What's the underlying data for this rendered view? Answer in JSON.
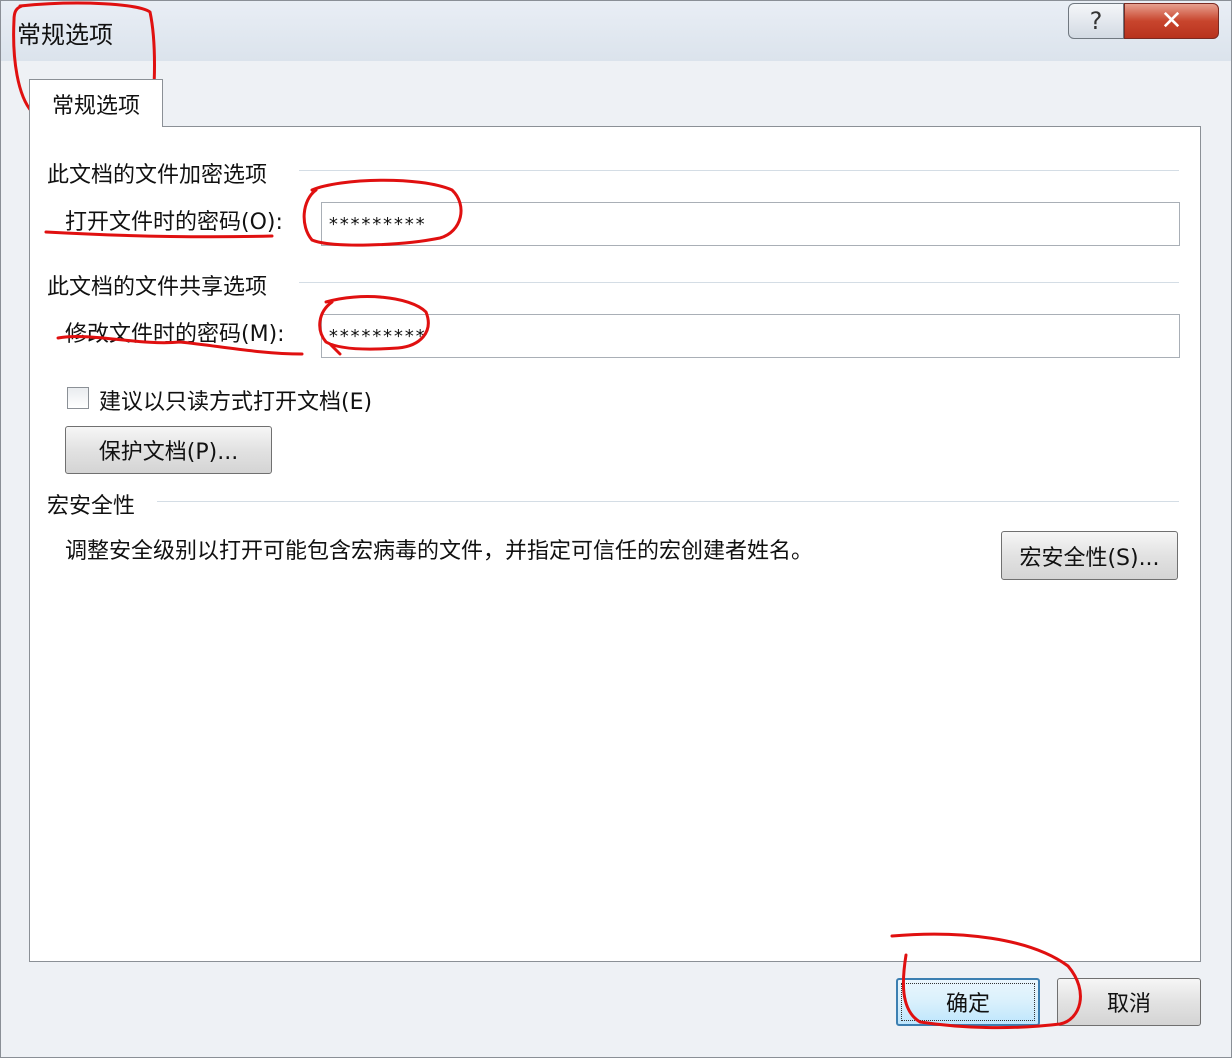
{
  "dialog": {
    "title": "常规选项",
    "help_glyph": "?",
    "close_glyph": "✕"
  },
  "tab": {
    "label": "常规选项"
  },
  "encryption": {
    "group_label": "此文档的文件加密选项",
    "open_password_label": "打开文件时的密码(O):",
    "open_password_value": "*********"
  },
  "sharing": {
    "group_label": "此文档的文件共享选项",
    "modify_password_label": "修改文件时的密码(M):",
    "modify_password_value": "*********",
    "readonly_label": "建议以只读方式打开文档(E)",
    "readonly_checked": false,
    "protect_button": "保护文档(P)..."
  },
  "macro": {
    "group_label": "宏安全性",
    "description": "调整安全级别以打开可能包含宏病毒的文件，并指定可信任的宏创建者姓名。",
    "button": "宏安全性(S)..."
  },
  "footer": {
    "ok": "确定",
    "cancel": "取消"
  },
  "annotation_color": "#e01010"
}
